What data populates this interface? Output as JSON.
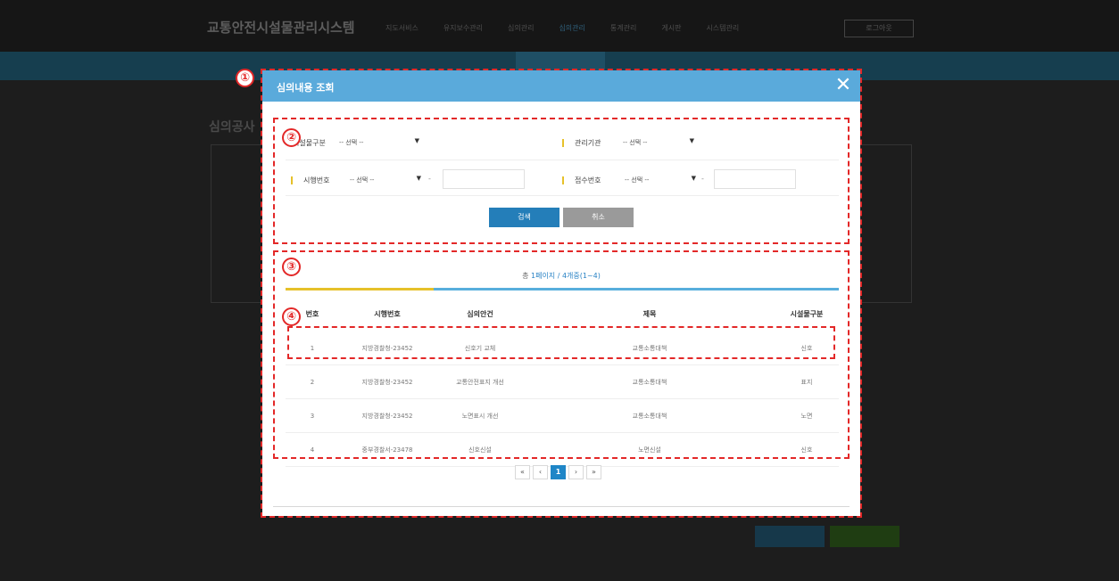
{
  "app": {
    "title": "교통안전시설물관리시스템",
    "nav": [
      "지도서비스",
      "유지보수관리",
      "심의관리",
      "심의관리",
      "통계관리",
      "게시판",
      "시스템관리"
    ],
    "logout_label": "로그아웃"
  },
  "background": {
    "page_title": "심의공사"
  },
  "modal": {
    "title": "심의내용 조회",
    "close_icon": "close-icon",
    "search_form": {
      "facility_type_label": "시설물구분",
      "facility_type_value": "-- 선택 --",
      "agency_label": "관리기관",
      "agency_value": "-- 선택 --",
      "enforcement_no_label": "시행번호",
      "enforcement_no_value": "-- 선택 --",
      "enforcement_no_text": "",
      "receipt_no_label": "접수번호",
      "receipt_no_value": "-- 선택 --",
      "receipt_no_text": "",
      "dash": "-",
      "search_button": "검색",
      "cancel_button": "취소"
    },
    "results": {
      "summary_prefix": "총 ",
      "summary_highlight": "1페이지 / 4개중(1~4)",
      "columns": [
        "번호",
        "시행번호",
        "심의안건",
        "제목",
        "시설물구분"
      ],
      "rows": [
        [
          "1",
          "지방경찰청-23452",
          "신호기 교체",
          "교통소통대책",
          "신호"
        ],
        [
          "2",
          "지방경찰청-23452",
          "교통안전표지 개선",
          "교통소통대책",
          "표지"
        ],
        [
          "3",
          "지방경찰청-23452",
          "노면표시 개선",
          "교통소통대책",
          "노면"
        ],
        [
          "4",
          "중부경찰서-23478",
          "신호신설",
          "노면신설",
          "신호"
        ]
      ]
    },
    "pagination": {
      "first": "«",
      "prev": "‹",
      "current": "1",
      "next": "›",
      "last": "»"
    }
  },
  "annotations": [
    "①",
    "②",
    "③",
    "④"
  ],
  "colors": {
    "modal_header": "#5aaadb",
    "search_button": "#247eb9",
    "cancel_button": "#9a9a9a",
    "annotation": "#e32828",
    "accent_yellow": "#e6c12a"
  }
}
